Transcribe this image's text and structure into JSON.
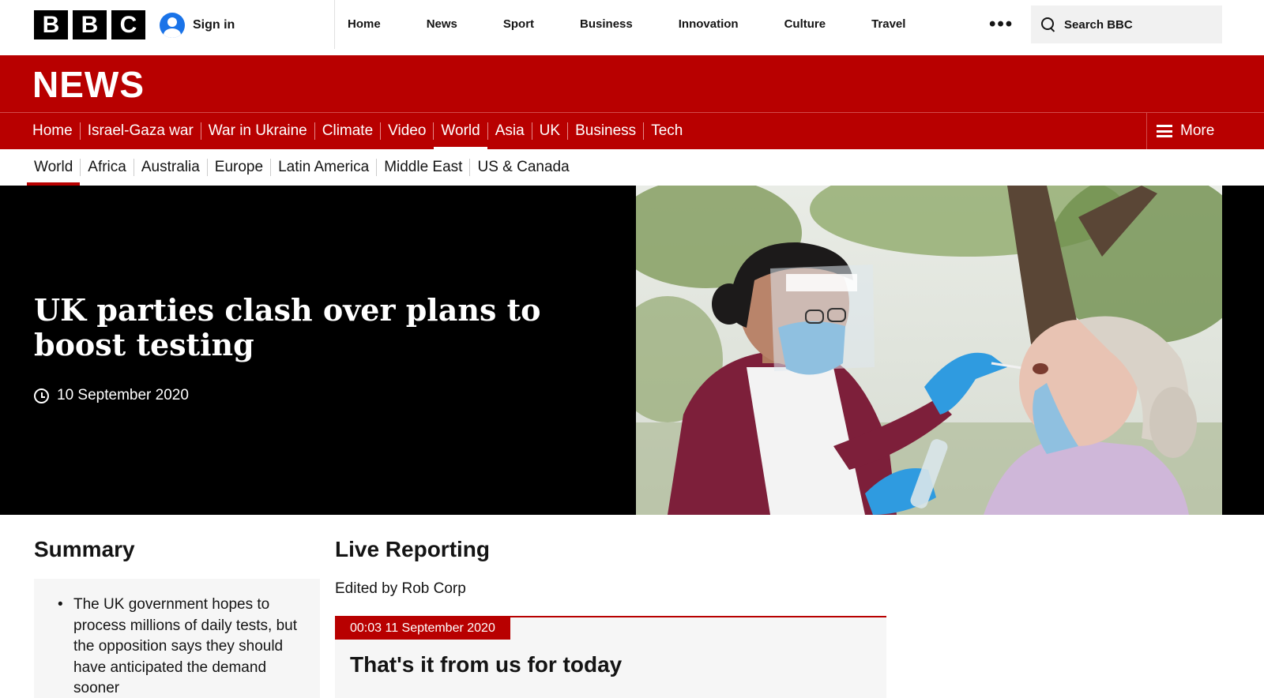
{
  "topbar": {
    "logo_letters": [
      "B",
      "B",
      "C"
    ],
    "signin_label": "Sign in",
    "nav": [
      "Home",
      "News",
      "Sport",
      "Business",
      "Innovation",
      "Culture",
      "Travel"
    ],
    "more_label": "•••",
    "search_label": "Search BBC"
  },
  "news_banner": {
    "brand": "NEWS"
  },
  "main_nav": {
    "items": [
      "Home",
      "Israel-Gaza war",
      "War in Ukraine",
      "Climate",
      "Video",
      "World",
      "Asia",
      "UK",
      "Business",
      "Tech"
    ],
    "active": "World",
    "more_label": "More"
  },
  "sub_nav": {
    "items": [
      "World",
      "Africa",
      "Australia",
      "Europe",
      "Latin America",
      "Middle East",
      "US & Canada"
    ],
    "active": "World"
  },
  "hero": {
    "headline": "UK parties clash over plans to boost testing",
    "date": "10 September 2020"
  },
  "summary": {
    "title": "Summary",
    "bullets": [
      "The UK government hopes to process millions of daily tests, but the opposition says they should have anticipated the demand sooner"
    ]
  },
  "live": {
    "title": "Live Reporting",
    "edited_by": "Edited by Rob Corp",
    "post": {
      "timestamp": "00:03 11 September 2020",
      "title": "That's it from us for today"
    }
  },
  "colors": {
    "brand_red": "#b80000",
    "black": "#000000",
    "link_blue": "#1a73e8"
  }
}
